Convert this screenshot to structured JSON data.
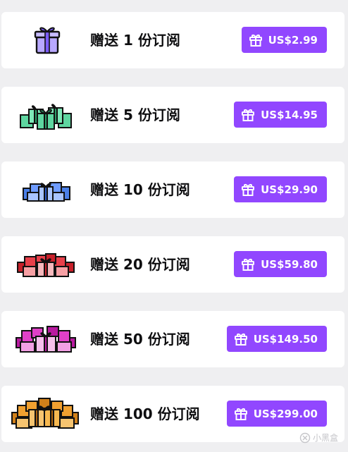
{
  "offers": [
    {
      "label": "赠送 1 份订阅",
      "price": "US$2.99",
      "color": "#b8a8ff",
      "box_count": 1
    },
    {
      "label": "赠送 5 份订阅",
      "price": "US$14.95",
      "color": "#5ed6a0",
      "box_count": 5
    },
    {
      "label": "赠送 10 份订阅",
      "price": "US$29.90",
      "color": "#4a7fe8",
      "box_count": 10
    },
    {
      "label": "赠送 20 份订阅",
      "price": "US$59.80",
      "color": "#e8404a",
      "box_count": 20
    },
    {
      "label": "赠送 50 份订阅",
      "price": "US$149.50",
      "color": "#e040c8",
      "box_count": 50
    },
    {
      "label": "赠送 100 份订阅",
      "price": "US$299.00",
      "color": "#f0a030",
      "box_count": 100
    }
  ],
  "accent_color": "#9147ff",
  "button_icon": "gift-icon",
  "watermark": {
    "text": "小黑盒",
    "icon": "watermark-logo-icon"
  }
}
